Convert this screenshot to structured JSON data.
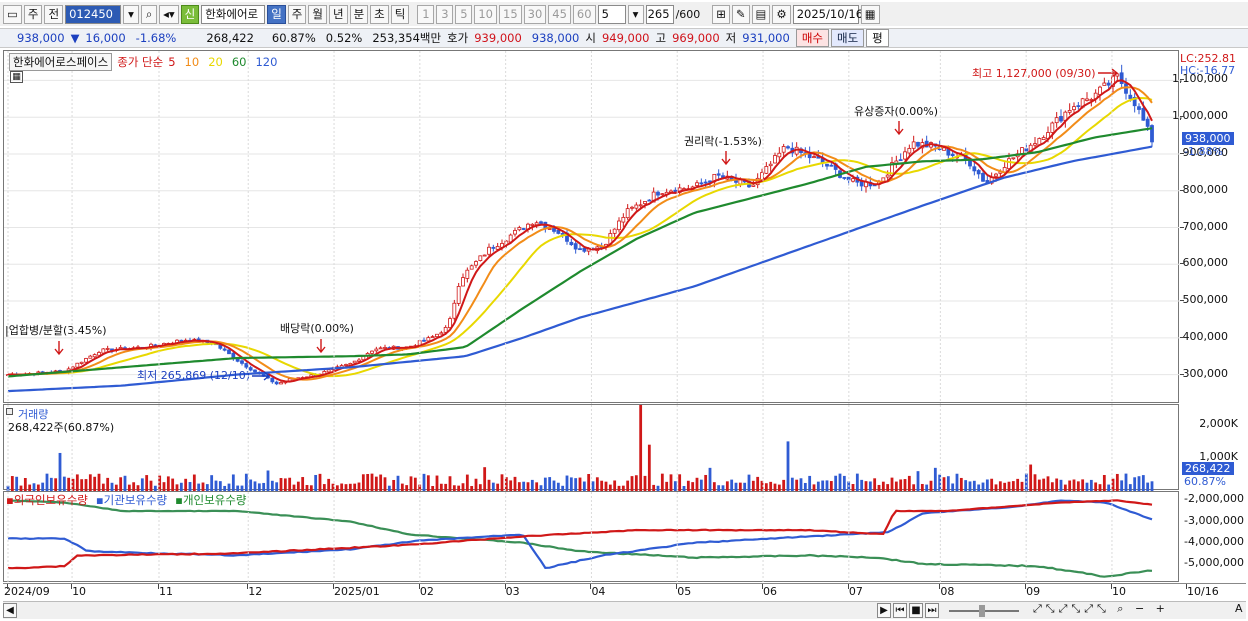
{
  "toolbar": {
    "period_toggle": "주",
    "prev_label": "전",
    "code": "012450",
    "market_badge": "신",
    "stock_name": "한화에어로",
    "tf_active": "일",
    "tf": [
      "주",
      "월",
      "년",
      "분",
      "초",
      "틱"
    ],
    "minutes": [
      "1",
      "3",
      "5",
      "10",
      "15",
      "30",
      "45",
      "60"
    ],
    "mins_value": "5",
    "count": "265",
    "count_total": "/600",
    "date": "2025/10/16"
  },
  "quote": {
    "price": "938,000",
    "arrow": "▼",
    "change": "16,000",
    "change_pct": "-1.68%",
    "volume": "268,422",
    "vol_ratio": "60.87%",
    "turnover": "0.52%",
    "amount": "253,354백만",
    "bid_label": "호가",
    "bid1": "939,000",
    "bid2": "938,000",
    "open_label": "시",
    "open": "949,000",
    "high_label": "고",
    "high": "969,000",
    "low_label": "저",
    "low": "931,000",
    "buy": "매수",
    "sell": "매도",
    "flat": "평"
  },
  "main": {
    "legend_name": "한화에어로스페이스",
    "legend_ma": "종가 단순",
    "ma": [
      {
        "p": "5",
        "c": "#d01818"
      },
      {
        "p": "10",
        "c": "#f28c18"
      },
      {
        "p": "20",
        "c": "#e8d800"
      },
      {
        "p": "60",
        "c": "#1f8a2e"
      },
      {
        "p": "120",
        "c": "#2f5bd3"
      }
    ],
    "axis": [
      "1,100,000",
      "1,000,000",
      "900,000",
      "800,000",
      "700,000",
      "600,000",
      "500,000",
      "400,000",
      "300,000"
    ],
    "lc": "LC:252.81",
    "hc": "HC:-16.77",
    "price_tag": "938,000",
    "price_pct": "-1.88%",
    "ann_high": "최고 1,127,000 (09/30)",
    "ann_low": "최저 265,869 (12/10)",
    "ann_merge": "|업합병/분할(3.45%)",
    "ann_div": "배당락(0.00%)",
    "ann_rights": "권리락(-1.53%)",
    "ann_capinc": "유상증자(0.00%)"
  },
  "volume": {
    "title": "거래량",
    "value": "268,422주(60.87%)",
    "axis": [
      "2,000K",
      "1,000K"
    ],
    "tag": "268,422",
    "tag_pct": "60.87%"
  },
  "holders": {
    "l1": "외국인보유수량",
    "l2": "기관보유수량",
    "l3": "개인보유수량",
    "axis": [
      "-2,000,000",
      "-3,000,000",
      "-4,000,000",
      "-5,000,000"
    ]
  },
  "xaxis": [
    "2024/09",
    "10",
    "11",
    "12",
    "2025/01",
    "02",
    "03",
    "04",
    "05",
    "06",
    "07",
    "08",
    "09",
    "10",
    "10/16"
  ],
  "chart_data": {
    "type": "candlestick",
    "title": "한화에어로스페이스",
    "ylim": [
      220000,
      1180000
    ],
    "months": [
      "2024/09",
      "10",
      "11",
      "12",
      "2025/01",
      "02",
      "03",
      "04",
      "05",
      "06",
      "07",
      "08",
      "09",
      "10"
    ],
    "close_path": [
      [
        0,
        300000
      ],
      [
        0.03,
        305000
      ],
      [
        0.05,
        310000
      ],
      [
        0.08,
        365000
      ],
      [
        0.12,
        375000
      ],
      [
        0.155,
        395000
      ],
      [
        0.18,
        385000
      ],
      [
        0.2,
        340000
      ],
      [
        0.22,
        300000
      ],
      [
        0.235,
        275000
      ],
      [
        0.25,
        290000
      ],
      [
        0.27,
        300000
      ],
      [
        0.3,
        330000
      ],
      [
        0.32,
        370000
      ],
      [
        0.35,
        375000
      ],
      [
        0.37,
        400000
      ],
      [
        0.385,
        430000
      ],
      [
        0.395,
        560000
      ],
      [
        0.42,
        640000
      ],
      [
        0.44,
        680000
      ],
      [
        0.46,
        720000
      ],
      [
        0.48,
        690000
      ],
      [
        0.5,
        640000
      ],
      [
        0.52,
        650000
      ],
      [
        0.54,
        740000
      ],
      [
        0.57,
        800000
      ],
      [
        0.6,
        810000
      ],
      [
        0.62,
        840000
      ],
      [
        0.65,
        810000
      ],
      [
        0.68,
        920000
      ],
      [
        0.71,
        880000
      ],
      [
        0.74,
        820000
      ],
      [
        0.76,
        820000
      ],
      [
        0.79,
        930000
      ],
      [
        0.81,
        920000
      ],
      [
        0.84,
        880000
      ],
      [
        0.855,
        820000
      ],
      [
        0.87,
        870000
      ],
      [
        0.9,
        940000
      ],
      [
        0.93,
        1030000
      ],
      [
        0.95,
        1060000
      ],
      [
        0.97,
        1110000
      ],
      [
        0.985,
        1040000
      ],
      [
        1,
        938000
      ]
    ],
    "ma60_path": [
      [
        0,
        295000
      ],
      [
        0.1,
        320000
      ],
      [
        0.2,
        345000
      ],
      [
        0.3,
        350000
      ],
      [
        0.35,
        355000
      ],
      [
        0.4,
        375000
      ],
      [
        0.45,
        480000
      ],
      [
        0.5,
        580000
      ],
      [
        0.55,
        670000
      ],
      [
        0.6,
        740000
      ],
      [
        0.65,
        780000
      ],
      [
        0.7,
        820000
      ],
      [
        0.75,
        865000
      ],
      [
        0.8,
        880000
      ],
      [
        0.85,
        885000
      ],
      [
        0.9,
        905000
      ],
      [
        0.95,
        945000
      ],
      [
        1,
        970000
      ]
    ],
    "ma120_path": [
      [
        0,
        255000
      ],
      [
        0.1,
        270000
      ],
      [
        0.2,
        300000
      ],
      [
        0.3,
        320000
      ],
      [
        0.4,
        350000
      ],
      [
        0.45,
        400000
      ],
      [
        0.5,
        455000
      ],
      [
        0.6,
        540000
      ],
      [
        0.7,
        650000
      ],
      [
        0.8,
        760000
      ],
      [
        0.87,
        835000
      ],
      [
        0.93,
        880000
      ],
      [
        1,
        920000
      ]
    ],
    "foreign_path": [
      [
        0,
        -5200000
      ],
      [
        0.05,
        -5100000
      ],
      [
        0.06,
        -4600000
      ],
      [
        0.2,
        -4500000
      ],
      [
        0.35,
        -4100000
      ],
      [
        0.45,
        -3700000
      ],
      [
        0.55,
        -3400000
      ],
      [
        0.7,
        -3400000
      ],
      [
        0.765,
        -3600000
      ],
      [
        0.775,
        -2500000
      ],
      [
        0.82,
        -2500000
      ],
      [
        0.92,
        -2100000
      ],
      [
        0.97,
        -2000000
      ],
      [
        1,
        -2200000
      ]
    ],
    "inst_path": [
      [
        0,
        -3800000
      ],
      [
        0.05,
        -3800000
      ],
      [
        0.07,
        -4400000
      ],
      [
        0.2,
        -4600000
      ],
      [
        0.3,
        -4300000
      ],
      [
        0.36,
        -3900000
      ],
      [
        0.45,
        -3600000
      ],
      [
        0.47,
        -5200000
      ],
      [
        0.52,
        -4600000
      ],
      [
        0.6,
        -4000000
      ],
      [
        0.7,
        -3700000
      ],
      [
        0.77,
        -3500000
      ],
      [
        0.8,
        -2600000
      ],
      [
        0.88,
        -2300000
      ],
      [
        0.92,
        -2000000
      ],
      [
        0.96,
        -2100000
      ],
      [
        1,
        -2900000
      ]
    ],
    "indiv_path": [
      [
        0,
        -2000000
      ],
      [
        0.05,
        -2100000
      ],
      [
        0.1,
        -2500000
      ],
      [
        0.2,
        -2500000
      ],
      [
        0.3,
        -3000000
      ],
      [
        0.35,
        -3600000
      ],
      [
        0.45,
        -4000000
      ],
      [
        0.5,
        -4400000
      ],
      [
        0.6,
        -4700000
      ],
      [
        0.7,
        -4600000
      ],
      [
        0.76,
        -4700000
      ],
      [
        0.8,
        -5000000
      ],
      [
        0.9,
        -5100000
      ],
      [
        0.96,
        -5600000
      ],
      [
        1,
        -5300000
      ]
    ]
  }
}
